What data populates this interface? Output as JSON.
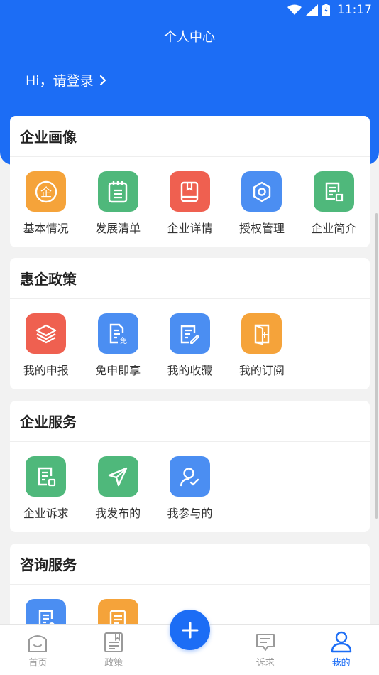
{
  "status_bar": {
    "time": "11:17"
  },
  "header": {
    "title": "个人中心",
    "login_text": "Hi，请登录"
  },
  "colors": {
    "primary": "#1c6df5",
    "orange": "#f5a33a",
    "green": "#4fb87b",
    "red": "#ef6050",
    "blue": "#4b8ef2"
  },
  "sections": [
    {
      "title": "企业画像",
      "items": [
        {
          "label": "基本情况",
          "icon": "enterprise-icon",
          "color": "#f5a33a"
        },
        {
          "label": "发展清单",
          "icon": "checklist-icon",
          "color": "#4fb87b"
        },
        {
          "label": "企业详情",
          "icon": "book-icon",
          "color": "#ef6050"
        },
        {
          "label": "授权管理",
          "icon": "gear-icon",
          "color": "#4b8ef2"
        },
        {
          "label": "企业简介",
          "icon": "document-icon",
          "color": "#4fb87b"
        }
      ]
    },
    {
      "title": "惠企政策",
      "items": [
        {
          "label": "我的申报",
          "icon": "layers-icon",
          "color": "#ef6050"
        },
        {
          "label": "免申即享",
          "icon": "exempt-document-icon",
          "color": "#4b8ef2"
        },
        {
          "label": "我的收藏",
          "icon": "edit-document-icon",
          "color": "#4b8ef2"
        },
        {
          "label": "我的订阅",
          "icon": "door-icon",
          "color": "#f5a33a"
        }
      ]
    },
    {
      "title": "企业服务",
      "items": [
        {
          "label": "企业诉求",
          "icon": "request-document-icon",
          "color": "#4fb87b"
        },
        {
          "label": "我发布的",
          "icon": "send-icon",
          "color": "#4fb87b"
        },
        {
          "label": "我参与的",
          "icon": "user-check-icon",
          "color": "#4b8ef2"
        }
      ]
    },
    {
      "title": "咨询服务",
      "items": [
        {
          "label": "",
          "icon": "consult-document-icon",
          "color": "#4b8ef2"
        },
        {
          "label": "",
          "icon": "list-document-icon",
          "color": "#f5a33a"
        }
      ]
    }
  ],
  "tabbar": {
    "items": [
      {
        "label": "首页",
        "icon": "home-icon",
        "active": false
      },
      {
        "label": "政策",
        "icon": "policy-icon",
        "active": false
      },
      {
        "label": "",
        "icon": "plus-icon",
        "active": false
      },
      {
        "label": "诉求",
        "icon": "message-icon",
        "active": false
      },
      {
        "label": "我的",
        "icon": "user-icon",
        "active": true
      }
    ]
  }
}
